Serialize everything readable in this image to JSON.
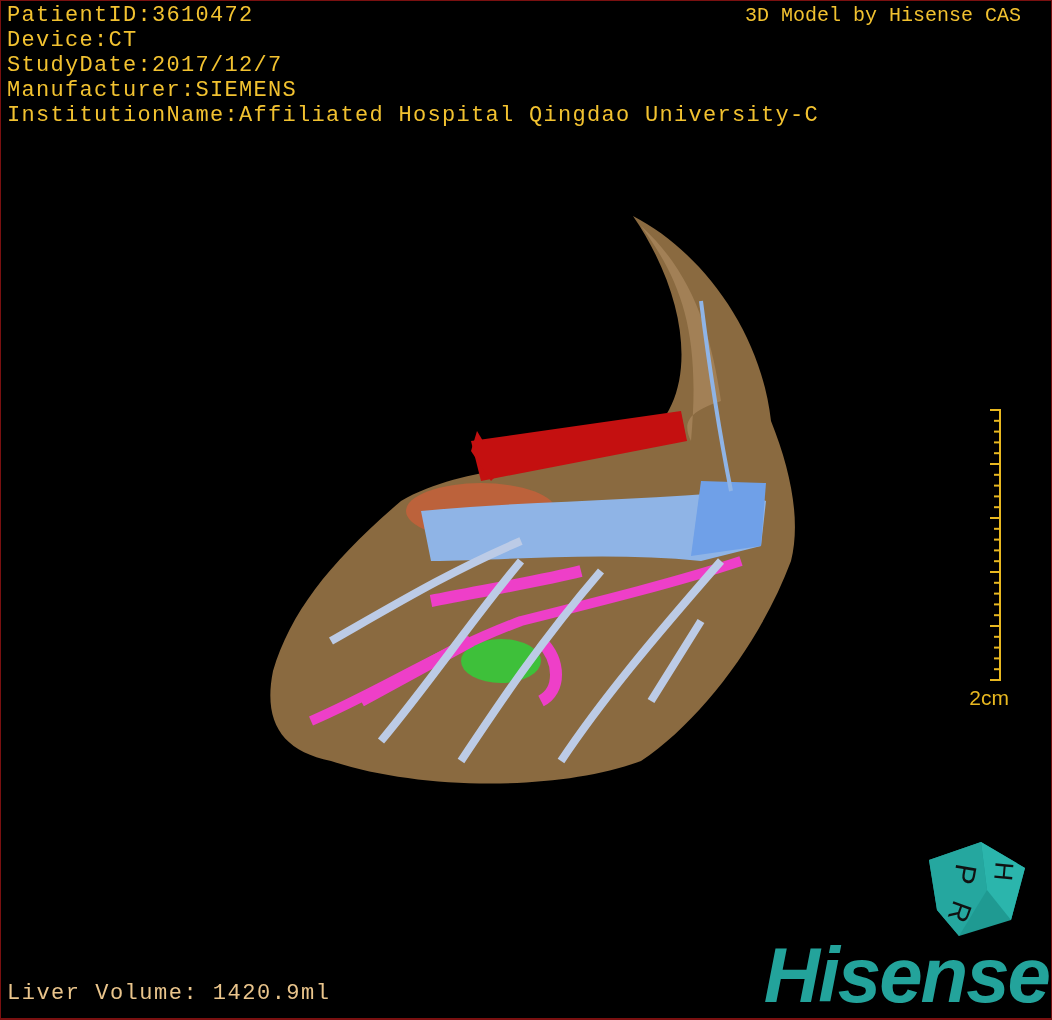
{
  "study_info": [
    "PatientID:3610472",
    "Device:CT",
    "StudyDate:2017/12/7",
    "Manufacturer:SIEMENS",
    "InstitutionName:Affiliated Hospital Qingdao University-C"
  ],
  "credit": "3D Model by Hisense CAS",
  "scale_bar": {
    "label": "2cm"
  },
  "liver_volume": "Liver Volume: 1420.9ml",
  "orientation_cube": {
    "letters": [
      "P",
      "H",
      "R"
    ]
  },
  "logo": "Hisense"
}
